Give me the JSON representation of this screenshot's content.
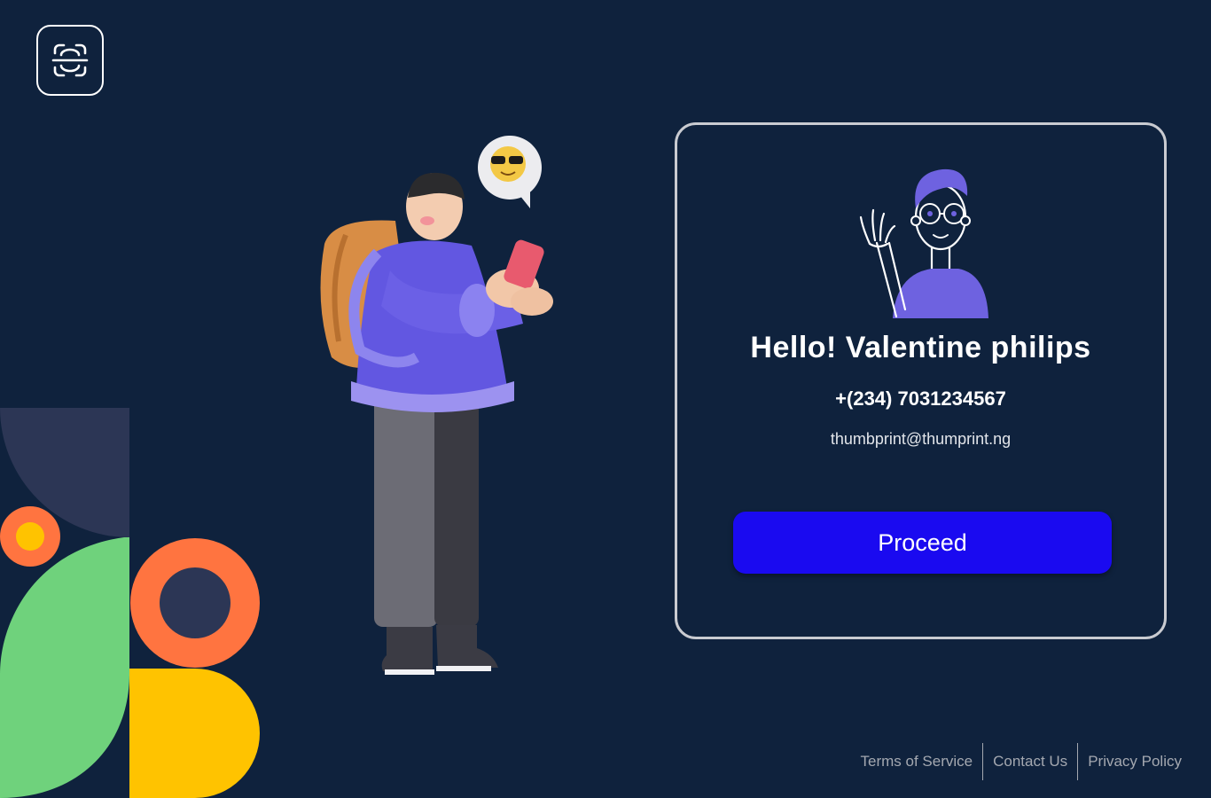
{
  "brand": {
    "logo_icon": "face-scan-icon"
  },
  "profile": {
    "greeting": "Hello! Valentine philips",
    "phone": "+(234) 7031234567",
    "email": "thumbprint@thumprint.ng",
    "avatar_icon": "waving-person-icon"
  },
  "actions": {
    "proceed_label": "Proceed"
  },
  "footer": {
    "links": [
      "Terms of Service",
      "Contact Us",
      "Privacy Policy"
    ]
  },
  "colors": {
    "background": "#0f223d",
    "primary_button": "#1a0af0",
    "card_border": "#c9cbd1",
    "accent_purple": "#6e62e0",
    "shape_green": "#6fd27c",
    "shape_orange": "#ff7440",
    "shape_yellow": "#ffc300",
    "shape_navy": "#2c3655"
  }
}
